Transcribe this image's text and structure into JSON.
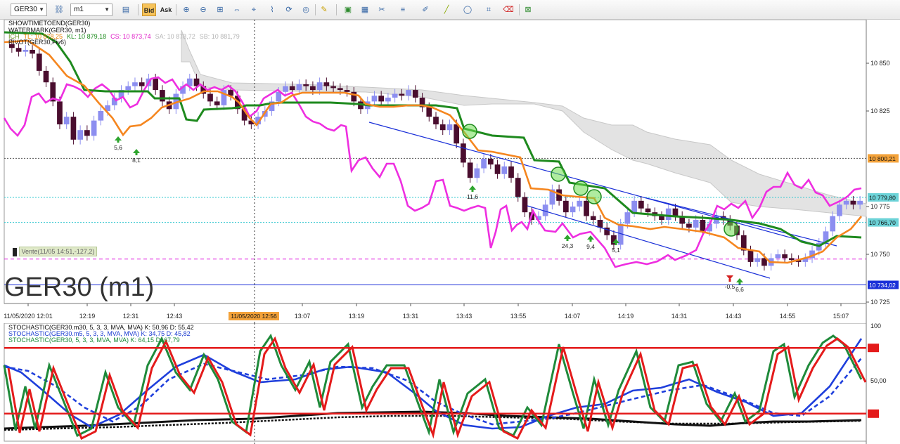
{
  "toolbar": {
    "symbol": "GER30",
    "timeframe": "m1",
    "bid_label": "Bid",
    "ask_label": "Ask"
  },
  "main": {
    "indicator_lines": {
      "line1": "SHOWTIMETOEND(GER30)",
      "line2": "WATERMARK(GER30, m1)",
      "ichimoku": [
        {
          "text": "ICH",
          "color": "#6b8e23"
        },
        {
          "text": "TL: 10 878,25",
          "color": "#e67e00"
        },
        {
          "text": "KL: 10 879,18",
          "color": "#1a8a1a"
        },
        {
          "text": "CS: 10 873,74",
          "color": "#e020c8"
        },
        {
          "text": "SA: 10 878,72",
          "color": "#b5b5b5"
        },
        {
          "text": "SB: 10 881,79",
          "color": "#b5b5b5"
        }
      ],
      "line4": "PIVOT(GER30,Fiv6)"
    },
    "watermark": "GER30 (m1)",
    "position_label": "Vente(11/05 14:51,-127,2)",
    "price_ticks": [
      "10 850",
      "10 825",
      "10 775",
      "10 750",
      "10 725"
    ],
    "price_tags": {
      "resistance": "10 800,21",
      "cyan_upper": "10 779,80",
      "cyan_lower": "10 766,70",
      "support": "10 734,02"
    },
    "time_ticks": [
      "11/05/2020 12:01",
      "12:19",
      "12:31",
      "12:43",
      "13:07",
      "13:19",
      "13:31",
      "13:43",
      "13:55",
      "14:07",
      "14:19",
      "14:31",
      "14:43",
      "14:55",
      "15:07"
    ],
    "cursor_time": "11/05/2020 12:56",
    "signals": [
      "5,6",
      "8,1",
      "11,6",
      "24,3",
      "9,4",
      "5,1",
      "-0,5",
      "6,6"
    ]
  },
  "stochastic": {
    "legend": [
      {
        "text": "STOCHASTIC(GER30.m30, 5, 3, 3, MVA, MVA)  K: 50,96  D: 55,42",
        "color": "#111111"
      },
      {
        "text": "STOCHASTIC(GER30.m5, 5, 3, 3, MVA, MVA)  K: 34,75  D: 45,82",
        "color": "#1a3ad0"
      },
      {
        "text": "STOCHASTIC(GER30, 5, 3, 3, MVA, MVA)  K: 64,15  D: 67,79",
        "color": "#1a8a3a"
      }
    ],
    "levels": {
      "top": "100",
      "upper": "80",
      "mid": "50,00",
      "lower": "20"
    }
  },
  "colors": {
    "tenkan": "#f5861f",
    "kijun": "#1e8a1e",
    "chikou": "#ee2ee0",
    "cloud": "#e3e3e3",
    "candle": "#8c8ef0",
    "candle_dark": "#4a0d2e",
    "channel": "#1a2fd8",
    "resistance_tag": "#f3a23a",
    "cyan_tag": "#6cd3d8",
    "support_tag": "#1a2fd8",
    "stoch_k_fast": "#1f8a3a",
    "stoch_d_fast": "#e41b1b",
    "stoch_m5": "#1f3fdc",
    "level_line": "#e41b1b",
    "cursor_time_bg": "#f3a23a"
  }
}
